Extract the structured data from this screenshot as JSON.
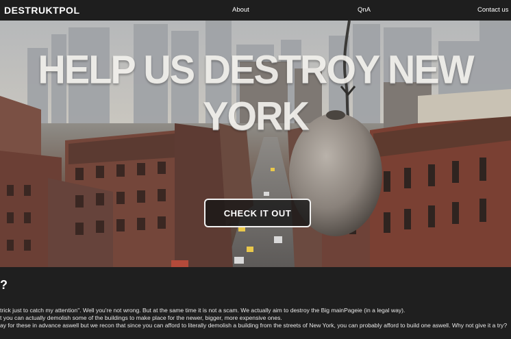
{
  "nav": {
    "logo": "DESTRUKTPOL",
    "links": [
      "About",
      "QnA",
      "Contact us"
    ]
  },
  "hero": {
    "title": "HELP US DESTROY NEW YORK",
    "cta_label": "CHECK IT OUT"
  },
  "content": {
    "heading": "?",
    "paragraphs": [
      "trick just to catch my attention\". Well you're not wrong. But at the same time it is not a scam. We actually aim to destroy the Big mainPageie (in a legal way).",
      "t you can actually demolish some of the buildings to make place for the newer, bigger, more expensive ones.",
      "ay for these in advance aswell but we recon that since you can afford to literally demolish a building from the streets of New York, you can probably afford to build one aswell. Why not give it a try?"
    ]
  },
  "colors": {
    "background": "#1f1f1f",
    "navbar": "#1e1e1e",
    "text": "#ffffff"
  }
}
